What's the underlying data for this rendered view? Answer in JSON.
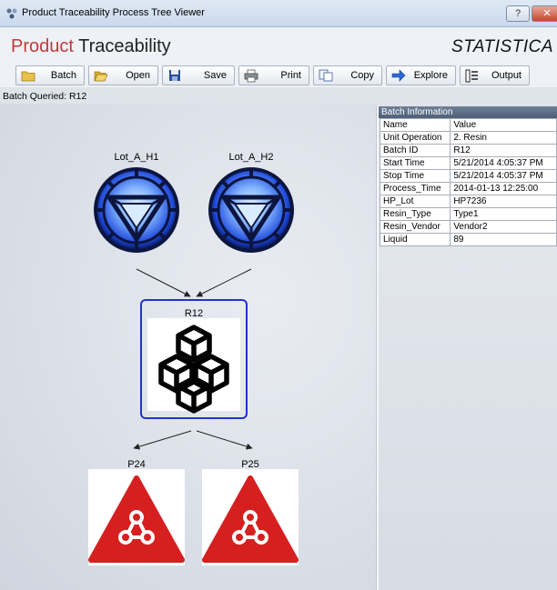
{
  "window": {
    "title": "Product Traceability Process Tree Viewer",
    "help_label": "?",
    "close_label": "✕"
  },
  "header": {
    "title_part1": "Product",
    "title_part2": "Traceability",
    "brand": "STATISTICA"
  },
  "toolbar": {
    "buttons": [
      {
        "label": "Batch",
        "icon": "folder-icon"
      },
      {
        "label": "Open",
        "icon": "open-folder-icon"
      },
      {
        "label": "Save",
        "icon": "save-disk-icon"
      },
      {
        "label": "Print",
        "icon": "printer-icon"
      },
      {
        "label": "Copy",
        "icon": "copy-icon"
      },
      {
        "label": "Explore",
        "icon": "arrow-right-icon"
      },
      {
        "label": "Output",
        "icon": "output-icon"
      }
    ]
  },
  "status": {
    "batch_queried": "Batch Queried: R12"
  },
  "tree": {
    "nodes": {
      "lot1": {
        "label": "Lot_A_H1",
        "icon": "arc-reactor-icon"
      },
      "lot2": {
        "label": "Lot_A_H2",
        "icon": "arc-reactor-icon"
      },
      "r12": {
        "label": "R12",
        "icon": "cubes-icon",
        "selected": true
      },
      "p24": {
        "label": "P24",
        "icon": "warning-network-icon"
      },
      "p25": {
        "label": "P25",
        "icon": "warning-network-icon"
      }
    }
  },
  "batch_info": {
    "title": "Batch Information",
    "columns": [
      "Name",
      "Value"
    ],
    "rows": [
      [
        "Unit Operation",
        "2. Resin"
      ],
      [
        "Batch ID",
        "R12"
      ],
      [
        "Start Time",
        "5/21/2014 4:05:37 PM"
      ],
      [
        "Stop Time",
        "5/21/2014 4:05:37 PM"
      ],
      [
        "Process_Time",
        "2014-01-13 12:25:00"
      ],
      [
        "HP_Lot",
        "HP7236"
      ],
      [
        "Resin_Type",
        "Type1"
      ],
      [
        "Resin_Vendor",
        "Vendor2"
      ],
      [
        "Liquid",
        "89"
      ]
    ]
  },
  "colors": {
    "accent_red": "#c03a3a",
    "selection_blue": "#2233cc",
    "warning_red": "#d62020",
    "reactor_blue": "#2f64e8"
  }
}
